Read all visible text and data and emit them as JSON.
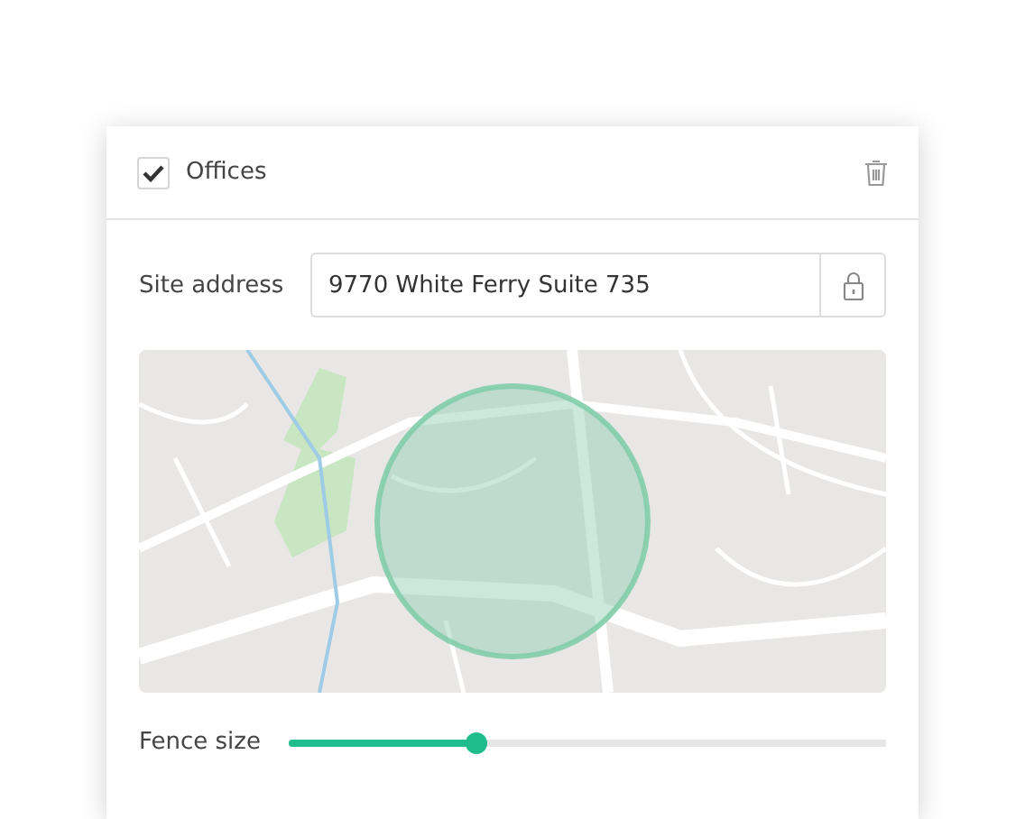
{
  "layer": {
    "label": "Offices",
    "checked": true
  },
  "address": {
    "label": "Site address",
    "value": "9770 White Ferry Suite 735"
  },
  "fence": {
    "label": "Fence size",
    "level": 0.315
  }
}
